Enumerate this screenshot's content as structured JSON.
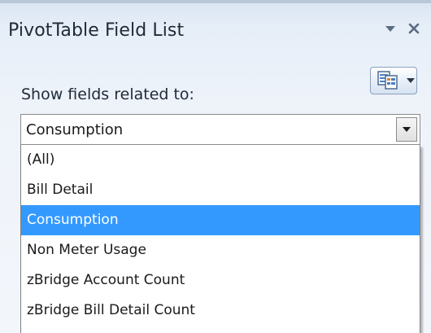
{
  "panel": {
    "title": "PivotTable Field List",
    "dropdown_icon": "chevron-down-icon",
    "close_icon": "close-icon",
    "layout_icon": "field-list-layout-icon"
  },
  "show_fields": {
    "label": "Show fields related to:",
    "selected_value": "Consumption",
    "options": [
      "(All)",
      "Bill Detail",
      "Consumption",
      "Non Meter Usage",
      "zBridge Account Count",
      "zBridge Bill Detail Count"
    ],
    "highlighted_index": 2
  },
  "colors": {
    "panel_bg": "#e6eef8",
    "highlight": "#3399ff",
    "title_text": "#1f2a38"
  }
}
